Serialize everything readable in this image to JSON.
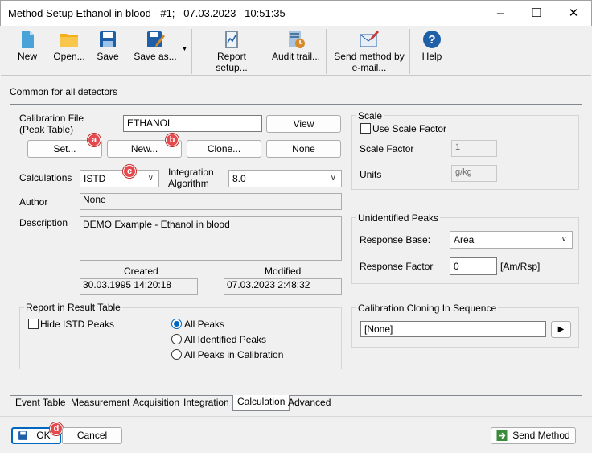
{
  "window": {
    "title": "Method Setup Ethanol in blood - #1;   07.03.2023   10:51:35"
  },
  "toolbar": {
    "new": "New",
    "open": "Open...",
    "save": "Save",
    "save_as": "Save as...",
    "report_setup": "Report setup...",
    "audit_trail": "Audit trail...",
    "send_method_line1": "Send method by",
    "send_method_line2": "e-mail...",
    "help": "Help"
  },
  "section_title": "Common for all detectors",
  "calibration": {
    "file_label_line1": "Calibration File",
    "file_label_line2": "(Peak Table)",
    "file_value": "ETHANOL",
    "view": "View",
    "set": "Set...",
    "new": "New...",
    "clone": "Clone...",
    "none": "None",
    "calculations_label": "Calculations",
    "calculations_value": "ISTD",
    "integration_label_line1": "Integration",
    "integration_label_line2": "Algorithm",
    "integration_value": "8.0",
    "author_label": "Author",
    "author_value": "None",
    "description_label": "Description",
    "description_value": "DEMO Example - Ethanol in blood",
    "created_label": "Created",
    "created_value": "30.03.1995 14:20:18",
    "modified_label": "Modified",
    "modified_value": "07.03.2023 2:48:32"
  },
  "report": {
    "title": "Report in Result Table",
    "hide_istd": "Hide ISTD Peaks",
    "all_peaks": "All Peaks",
    "all_identified": "All Identified Peaks",
    "all_in_calibration": "All Peaks in Calibration",
    "selected": "all_peaks"
  },
  "scale": {
    "title": "Scale",
    "use_scale_factor": "Use Scale Factor",
    "scale_factor_label": "Scale Factor",
    "scale_factor_value": "1",
    "units_label": "Units",
    "units_value": "g/kg"
  },
  "unidentified": {
    "title": "Unidentified Peaks",
    "response_base_label": "Response Base:",
    "response_base_value": "Area",
    "response_factor_label": "Response Factor",
    "response_factor_value": "0",
    "response_factor_unit": "[Am/Rsp]"
  },
  "cloning": {
    "title": "Calibration Cloning In Sequence",
    "value": "[None]"
  },
  "tabs": [
    "Event Table",
    "Measurement",
    "Acquisition",
    "Integration",
    "Calculation",
    "Advanced"
  ],
  "active_tab": "Calculation",
  "badges": {
    "a": "a",
    "b": "b",
    "c": "c",
    "d": "d"
  },
  "footer": {
    "ok": "OK",
    "cancel": "Cancel",
    "send_method": "Send Method"
  },
  "colors": {
    "badge": "#e5484d",
    "accent": "#0067c0"
  }
}
